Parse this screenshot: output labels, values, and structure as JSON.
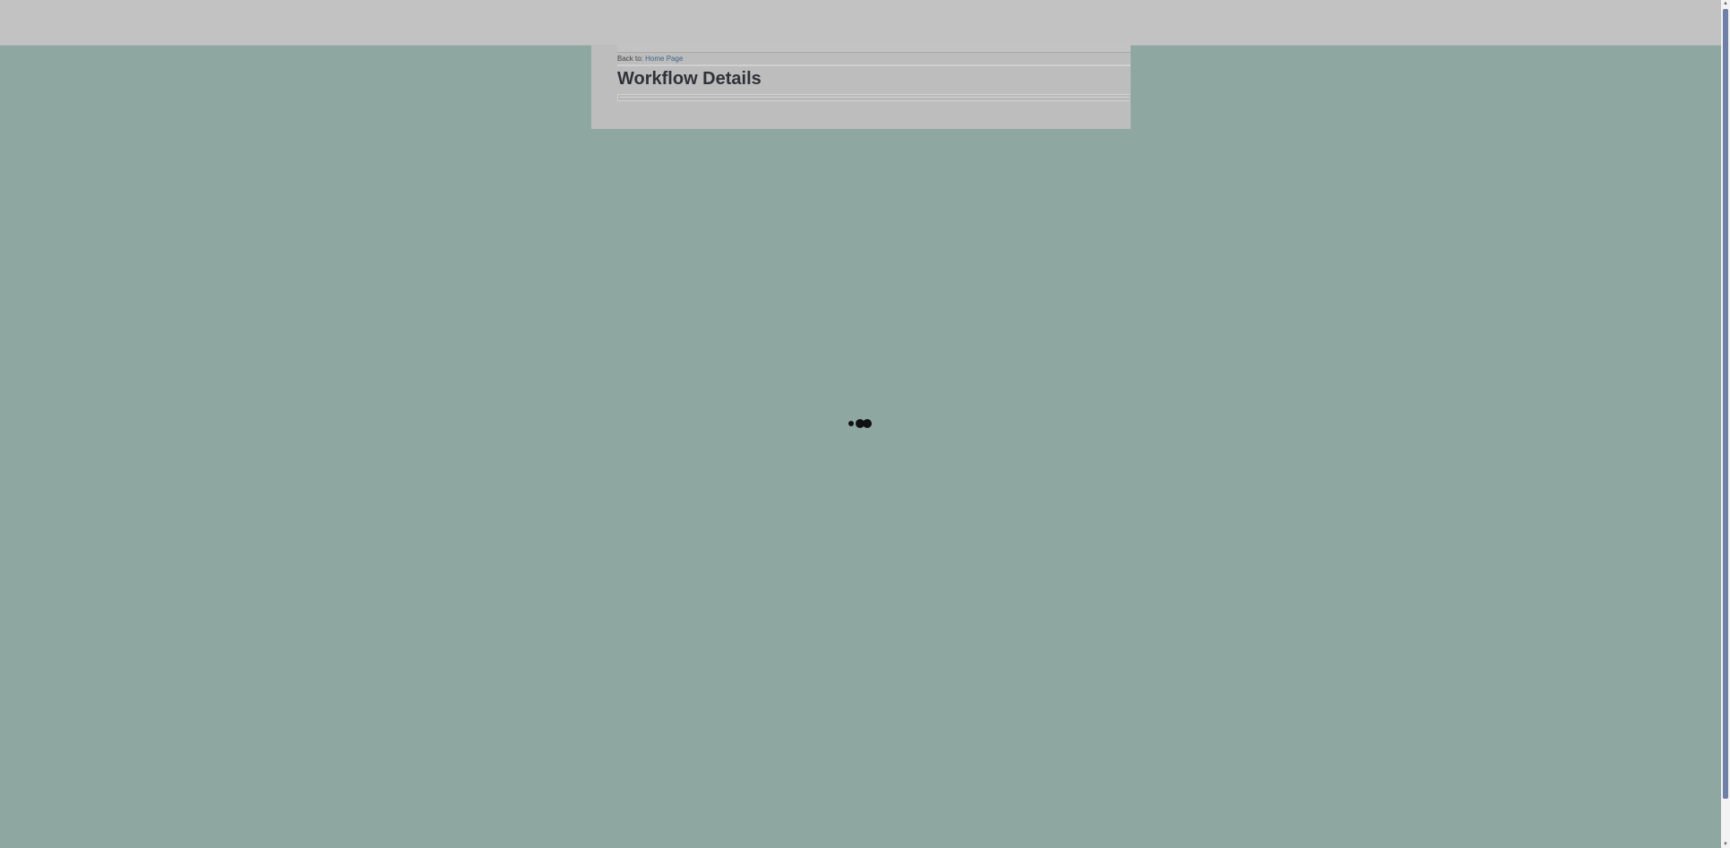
{
  "breadcrumb": {
    "prefix": "Back to:",
    "link_label": "Home Page"
  },
  "page": {
    "title": "Workflow Details"
  },
  "loading": {
    "indicator": "loading-dots-icon"
  },
  "colors": {
    "background": "#8ea7a0",
    "topbar": "#c2c2c2",
    "panel": "#bdbdbd",
    "title": "#2f3339",
    "link": "#3f6487",
    "scroll_thumb": "#6f7fa8"
  }
}
